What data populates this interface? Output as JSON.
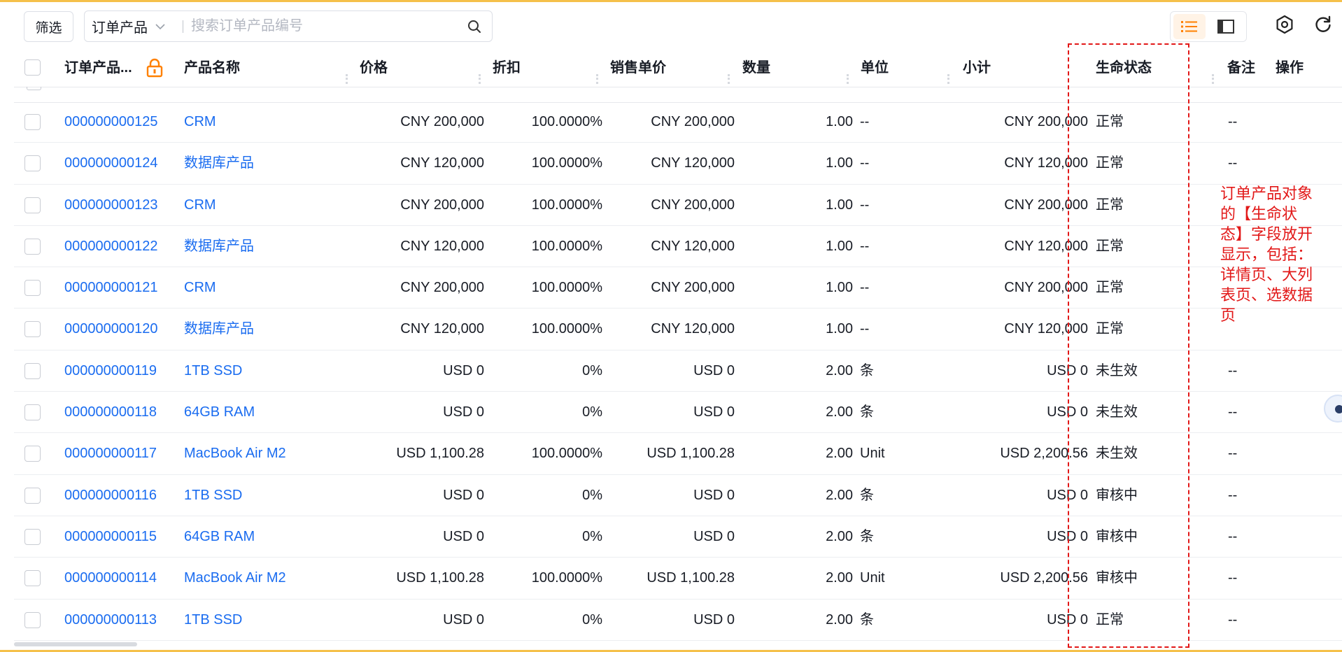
{
  "toolbar": {
    "filter_label": "筛选",
    "search_scope": "订单产品",
    "search_placeholder": "搜索订单产品编号"
  },
  "columns": {
    "code": "订单产品...",
    "name": "产品名称",
    "price": "价格",
    "discount": "折扣",
    "sale_price": "销售单价",
    "quantity": "数量",
    "unit": "单位",
    "subtotal": "小计",
    "lifecycle": "生命状态",
    "remark": "备注",
    "action": "操作"
  },
  "rows": [
    {
      "code": "000000000125",
      "name": "CRM",
      "price": "CNY 200,000",
      "discount": "100.0000%",
      "sale_price": "CNY 200,000",
      "quantity": "1.00",
      "unit": "--",
      "subtotal": "CNY 200,000",
      "lifecycle": "正常",
      "remark": "--"
    },
    {
      "code": "000000000124",
      "name": "数据库产品",
      "price": "CNY 120,000",
      "discount": "100.0000%",
      "sale_price": "CNY 120,000",
      "quantity": "1.00",
      "unit": "--",
      "subtotal": "CNY 120,000",
      "lifecycle": "正常",
      "remark": "--"
    },
    {
      "code": "000000000123",
      "name": "CRM",
      "price": "CNY 200,000",
      "discount": "100.0000%",
      "sale_price": "CNY 200,000",
      "quantity": "1.00",
      "unit": "--",
      "subtotal": "CNY 200,000",
      "lifecycle": "正常",
      "remark": ""
    },
    {
      "code": "000000000122",
      "name": "数据库产品",
      "price": "CNY 120,000",
      "discount": "100.0000%",
      "sale_price": "CNY 120,000",
      "quantity": "1.00",
      "unit": "--",
      "subtotal": "CNY 120,000",
      "lifecycle": "正常",
      "remark": ""
    },
    {
      "code": "000000000121",
      "name": "CRM",
      "price": "CNY 200,000",
      "discount": "100.0000%",
      "sale_price": "CNY 200,000",
      "quantity": "1.00",
      "unit": "--",
      "subtotal": "CNY 200,000",
      "lifecycle": "正常",
      "remark": ""
    },
    {
      "code": "000000000120",
      "name": "数据库产品",
      "price": "CNY 120,000",
      "discount": "100.0000%",
      "sale_price": "CNY 120,000",
      "quantity": "1.00",
      "unit": "--",
      "subtotal": "CNY 120,000",
      "lifecycle": "正常",
      "remark": ""
    },
    {
      "code": "000000000119",
      "name": "1TB SSD",
      "price": "USD 0",
      "discount": "0%",
      "sale_price": "USD 0",
      "quantity": "2.00",
      "unit": "条",
      "subtotal": "USD 0",
      "lifecycle": "未生效",
      "remark": "--"
    },
    {
      "code": "000000000118",
      "name": "64GB RAM",
      "price": "USD 0",
      "discount": "0%",
      "sale_price": "USD 0",
      "quantity": "2.00",
      "unit": "条",
      "subtotal": "USD 0",
      "lifecycle": "未生效",
      "remark": "--"
    },
    {
      "code": "000000000117",
      "name": "MacBook Air M2",
      "price": "USD 1,100.28",
      "discount": "100.0000%",
      "sale_price": "USD 1,100.28",
      "quantity": "2.00",
      "unit": "Unit",
      "subtotal": "USD 2,200.56",
      "lifecycle": "未生效",
      "remark": "--"
    },
    {
      "code": "000000000116",
      "name": "1TB SSD",
      "price": "USD 0",
      "discount": "0%",
      "sale_price": "USD 0",
      "quantity": "2.00",
      "unit": "条",
      "subtotal": "USD 0",
      "lifecycle": "审核中",
      "remark": "--"
    },
    {
      "code": "000000000115",
      "name": "64GB RAM",
      "price": "USD 0",
      "discount": "0%",
      "sale_price": "USD 0",
      "quantity": "2.00",
      "unit": "条",
      "subtotal": "USD 0",
      "lifecycle": "审核中",
      "remark": "--"
    },
    {
      "code": "000000000114",
      "name": "MacBook Air M2",
      "price": "USD 1,100.28",
      "discount": "100.0000%",
      "sale_price": "USD 1,100.28",
      "quantity": "2.00",
      "unit": "Unit",
      "subtotal": "USD 2,200.56",
      "lifecycle": "审核中",
      "remark": "--"
    },
    {
      "code": "000000000113",
      "name": "1TB SSD",
      "price": "USD 0",
      "discount": "0%",
      "sale_price": "USD 0",
      "quantity": "2.00",
      "unit": "条",
      "subtotal": "USD 0",
      "lifecycle": "正常",
      "remark": "--"
    }
  ],
  "annotation": {
    "text": "订单产品对象的【生命状态】字段放开显示，包括：详情页、大列表页、选数据页",
    "color": "#e21818"
  },
  "colors": {
    "link": "#1a6cf0",
    "accent": "#ff8000",
    "frame": "#f5c04a"
  },
  "icons": [
    "search-icon",
    "chevron-down-icon",
    "list-view-icon",
    "split-view-icon",
    "settings-icon",
    "refresh-icon",
    "lock-icon",
    "assistant-icon"
  ]
}
